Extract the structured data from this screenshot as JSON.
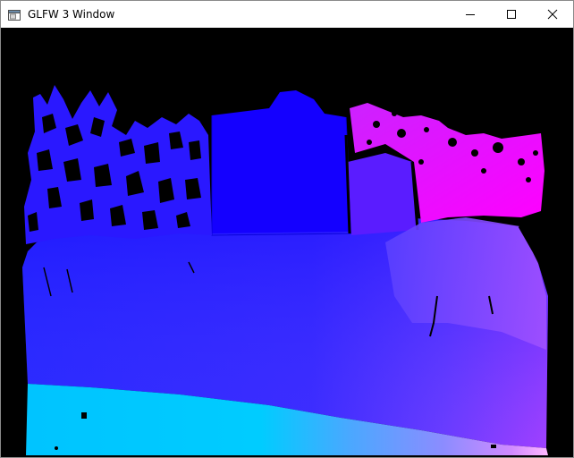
{
  "window": {
    "title": "GLFW 3 Window",
    "app_icon": "window-app-icon",
    "controls": {
      "minimize_icon": "minimize-icon",
      "maximize_icon": "maximize-icon",
      "close_icon": "close-icon"
    }
  },
  "viewport": {
    "content": "depth-colormap-render",
    "colors": {
      "background": "#000000",
      "near": "#00ccff",
      "mid": "#2a2aff",
      "far": "#0000ff",
      "farthest": "#ff00ff",
      "edge": "#ffb0ff"
    }
  }
}
